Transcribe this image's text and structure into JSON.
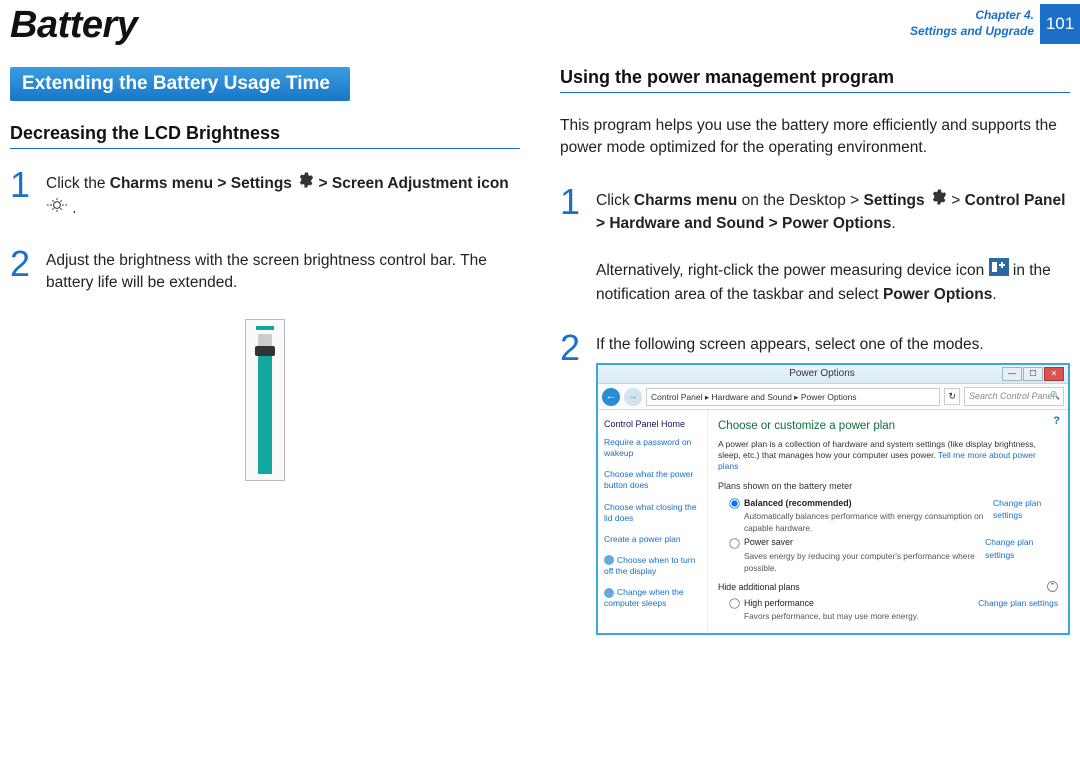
{
  "header": {
    "title": "Battery",
    "chapter_line1": "Chapter 4.",
    "chapter_line2": "Settings and Upgrade",
    "page_number": "101"
  },
  "left": {
    "banner": "Extending the Battery Usage Time",
    "subheading": "Decreasing the LCD Brightness",
    "step1": {
      "num": "1",
      "p1a": "Click the ",
      "p1b": "Charms menu > Settings ",
      "p1c": " > Screen Adjustment icon ",
      "p1d": " ."
    },
    "step2": {
      "num": "2",
      "text": "Adjust the brightness with the screen brightness control bar. The battery life will be extended."
    }
  },
  "right": {
    "subheading": "Using the power management program",
    "intro": "This program helps you use the battery more efficiently and supports the power mode optimized for the operating environment.",
    "step1": {
      "num": "1",
      "p1a": "Click ",
      "p1b": "Charms menu",
      "p1c": " on the Desktop > ",
      "p1d": "Settings ",
      "p1e": " > ",
      "p1f": "Control Panel > Hardware and Sound > Power Options",
      "p1g": ".",
      "p2a": "Alternatively, right-click the power measuring device icon ",
      "p2b": " in the notification area of the taskbar and select ",
      "p2c": "Power Options",
      "p2d": "."
    },
    "step2": {
      "num": "2",
      "text": "If the following screen appears, select one of the modes."
    }
  },
  "power_options": {
    "title": "Power Options",
    "breadcrumb": "Control Panel  ▸  Hardware and Sound  ▸  Power Options",
    "search_placeholder": "Search Control Panel",
    "side": {
      "home": "Control Panel Home",
      "l1": "Require a password on wakeup",
      "l2": "Choose what the power button does",
      "l3": "Choose what closing the lid does",
      "l4": "Create a power plan",
      "l5": "Choose when to turn off the display",
      "l6": "Change when the computer sleeps"
    },
    "main": {
      "heading": "Choose or customize a power plan",
      "desc1": "A power plan is a collection of hardware and system settings (like display brightness, sleep, etc.) that manages how your computer uses power. ",
      "desc_link": "Tell me more about power plans",
      "sub1": "Plans shown on the battery meter",
      "plan1_name": "Balanced (recommended)",
      "plan1_desc": "Automatically balances performance with energy consumption on capable hardware.",
      "plan2_name": "Power saver",
      "plan2_desc": "Saves energy by reducing your computer's performance where possible.",
      "change_link": "Change plan settings",
      "hide": "Hide additional plans",
      "plan3_name": "High performance",
      "plan3_desc": "Favors performance, but may use more energy."
    }
  }
}
